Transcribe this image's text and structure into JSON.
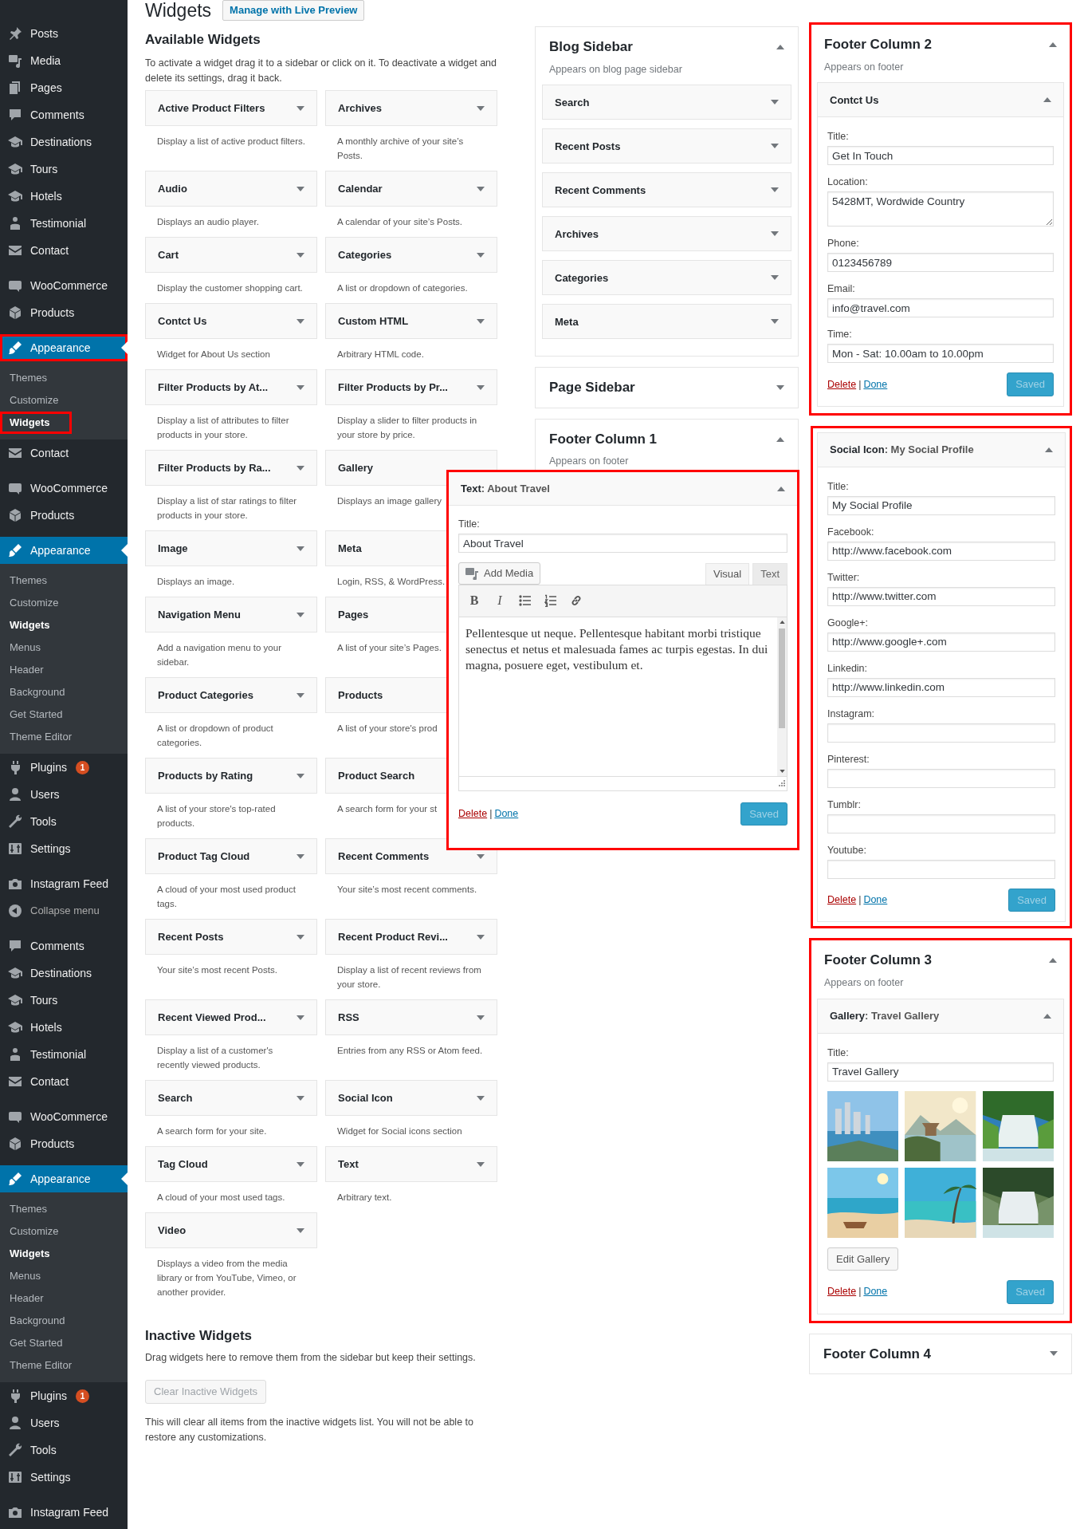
{
  "page": {
    "title": "Widgets",
    "live_preview": "Manage with Live Preview"
  },
  "admin_menu": [
    {
      "label": "Posts",
      "kind": "pin",
      "current": false,
      "highlighted": false
    },
    {
      "label": "Media",
      "kind": "media",
      "current": false,
      "highlighted": false
    },
    {
      "label": "Pages",
      "kind": "pages",
      "current": false,
      "highlighted": false
    },
    {
      "label": "Comments",
      "kind": "comment",
      "current": false,
      "highlighted": false
    },
    {
      "label": "Destinations",
      "kind": "cap",
      "current": false,
      "highlighted": false
    },
    {
      "label": "Tours",
      "kind": "cap",
      "current": false,
      "highlighted": false
    },
    {
      "label": "Hotels",
      "kind": "cap",
      "current": false,
      "highlighted": false
    },
    {
      "label": "Testimonial",
      "kind": "person",
      "current": false,
      "highlighted": false
    },
    {
      "label": "Contact",
      "kind": "mail",
      "current": false,
      "highlighted": false
    },
    {
      "label": "WooCommerce",
      "kind": "woo",
      "current": false,
      "highlighted": false
    },
    {
      "label": "Products",
      "kind": "cube",
      "current": false,
      "highlighted": false
    },
    {
      "label": "Appearance",
      "kind": "brush",
      "current": true,
      "highlighted": true,
      "submenu": [
        {
          "label": "Themes",
          "current": false,
          "highlighted": false
        },
        {
          "label": "Customize",
          "current": false,
          "highlighted": false
        },
        {
          "label": "Widgets",
          "current": true,
          "highlighted": true
        }
      ]
    },
    {
      "label": "Contact",
      "kind": "mail",
      "current": false,
      "highlighted": false
    },
    {
      "label": "WooCommerce",
      "kind": "woo",
      "current": false,
      "highlighted": false
    },
    {
      "label": "Products",
      "kind": "cube",
      "current": false,
      "highlighted": false
    },
    {
      "label": "Appearance",
      "kind": "brush",
      "current": true,
      "highlighted": false,
      "submenu": [
        {
          "label": "Themes",
          "current": false,
          "highlighted": false
        },
        {
          "label": "Customize",
          "current": false,
          "highlighted": false
        },
        {
          "label": "Widgets",
          "current": true,
          "highlighted": false
        },
        {
          "label": "Menus",
          "current": false,
          "highlighted": false
        },
        {
          "label": "Header",
          "current": false,
          "highlighted": false
        },
        {
          "label": "Background",
          "current": false,
          "highlighted": false
        },
        {
          "label": "Get Started",
          "current": false,
          "highlighted": false
        },
        {
          "label": "Theme Editor",
          "current": false,
          "highlighted": false
        }
      ]
    },
    {
      "label": "Plugins",
      "kind": "plug",
      "badge": "1",
      "current": false,
      "highlighted": false
    },
    {
      "label": "Users",
      "kind": "user",
      "current": false,
      "highlighted": false
    },
    {
      "label": "Tools",
      "kind": "wrench",
      "current": false,
      "highlighted": false
    },
    {
      "label": "Settings",
      "kind": "sliders",
      "current": false,
      "highlighted": false
    },
    {
      "label": "Instagram Feed",
      "kind": "camera",
      "current": false,
      "highlighted": false
    },
    {
      "label": "Collapse menu",
      "kind": "collapse",
      "current": false,
      "highlighted": false
    },
    {
      "label": "Comments",
      "kind": "comment",
      "current": false,
      "highlighted": false
    },
    {
      "label": "Destinations",
      "kind": "cap",
      "current": false,
      "highlighted": false
    },
    {
      "label": "Tours",
      "kind": "cap",
      "current": false,
      "highlighted": false
    },
    {
      "label": "Hotels",
      "kind": "cap",
      "current": false,
      "highlighted": false
    },
    {
      "label": "Testimonial",
      "kind": "person",
      "current": false,
      "highlighted": false
    },
    {
      "label": "Contact",
      "kind": "mail",
      "current": false,
      "highlighted": false
    },
    {
      "label": "WooCommerce",
      "kind": "woo",
      "current": false,
      "highlighted": false
    },
    {
      "label": "Products",
      "kind": "cube",
      "current": false,
      "highlighted": false
    },
    {
      "label": "Appearance",
      "kind": "brush",
      "current": true,
      "highlighted": false,
      "submenu": [
        {
          "label": "Themes",
          "current": false,
          "highlighted": false
        },
        {
          "label": "Customize",
          "current": false,
          "highlighted": false
        },
        {
          "label": "Widgets",
          "current": true,
          "highlighted": false
        },
        {
          "label": "Menus",
          "current": false,
          "highlighted": false
        },
        {
          "label": "Header",
          "current": false,
          "highlighted": false
        },
        {
          "label": "Background",
          "current": false,
          "highlighted": false
        },
        {
          "label": "Get Started",
          "current": false,
          "highlighted": false
        },
        {
          "label": "Theme Editor",
          "current": false,
          "highlighted": false
        }
      ]
    },
    {
      "label": "Plugins",
      "kind": "plug",
      "badge": "1",
      "current": false,
      "highlighted": false
    },
    {
      "label": "Users",
      "kind": "user",
      "current": false,
      "highlighted": false
    },
    {
      "label": "Tools",
      "kind": "wrench",
      "current": false,
      "highlighted": false
    },
    {
      "label": "Settings",
      "kind": "sliders",
      "current": false,
      "highlighted": false
    },
    {
      "label": "Instagram Feed",
      "kind": "camera",
      "current": false,
      "highlighted": false
    }
  ],
  "available": {
    "heading": "Available Widgets",
    "description": "To activate a widget drag it to a sidebar or click on it. To deactivate a widget and delete its settings, drag it back.",
    "widgets": [
      {
        "name": "Active Product Filters",
        "description": "Display a list of active product filters."
      },
      {
        "name": "Archives",
        "description": "A monthly archive of your site’s Posts."
      },
      {
        "name": "Audio",
        "description": "Displays an audio player."
      },
      {
        "name": "Calendar",
        "description": "A calendar of your site’s Posts."
      },
      {
        "name": "Cart",
        "description": "Display the customer shopping cart."
      },
      {
        "name": "Categories",
        "description": "A list or dropdown of categories."
      },
      {
        "name": "Contct Us",
        "description": "Widget for About Us section"
      },
      {
        "name": "Custom HTML",
        "description": "Arbitrary HTML code."
      },
      {
        "name": "Filter Products by At...",
        "description": "Display a list of attributes to filter products in your store."
      },
      {
        "name": "Filter Products by Pr...",
        "description": "Display a slider to filter products in your store by price."
      },
      {
        "name": "Filter Products by Ra...",
        "description": "Display a list of star ratings to filter products in your store."
      },
      {
        "name": "Gallery",
        "description": "Displays an image gallery"
      },
      {
        "name": "Image",
        "description": "Displays an image."
      },
      {
        "name": "Meta",
        "description": "Login, RSS, & WordPress."
      },
      {
        "name": "Navigation Menu",
        "description": "Add a navigation menu to your sidebar."
      },
      {
        "name": "Pages",
        "description": "A list of your site’s Pages."
      },
      {
        "name": "Product Categories",
        "description": "A list or dropdown of product categories."
      },
      {
        "name": "Products",
        "description": "A list of your store's prod"
      },
      {
        "name": "Products by Rating",
        "description": "A list of your store's top-rated products."
      },
      {
        "name": "Product Search",
        "description": "A search form for your st"
      },
      {
        "name": "Product Tag Cloud",
        "description": "A cloud of your most used product tags."
      },
      {
        "name": "Recent Comments",
        "description": "Your site’s most recent comments."
      },
      {
        "name": "Recent Posts",
        "description": "Your site’s most recent Posts."
      },
      {
        "name": "Recent Product Revi...",
        "description": "Display a list of recent reviews from your store."
      },
      {
        "name": "Recent Viewed Prod...",
        "description": "Display a list of a customer's recently viewed products."
      },
      {
        "name": "RSS",
        "description": "Entries from any RSS or Atom feed."
      },
      {
        "name": "Search",
        "description": "A search form for your site."
      },
      {
        "name": "Social Icon",
        "description": "Widget for Social icons section"
      },
      {
        "name": "Tag Cloud",
        "description": "A cloud of your most used tags."
      },
      {
        "name": "Text",
        "description": "Arbitrary text."
      },
      {
        "name": "Video",
        "description": "Displays a video from the media library or from YouTube, Vimeo, or another provider."
      }
    ]
  },
  "inactive": {
    "heading": "Inactive Widgets",
    "description": "Drag widgets here to remove them from the sidebar but keep their settings.",
    "clear_button": {
      "label": "Clear Inactive Widgets",
      "disabled": true
    },
    "note": "This will clear all items from the inactive widgets list. You will not be able to restore any customizations."
  },
  "sidebars": [
    {
      "title": "Blog Sidebar",
      "description": "Appears on blog page sidebar",
      "expanded": true,
      "highlighted": false,
      "widgets": [
        {
          "name": "Search",
          "expanded": false
        },
        {
          "name": "Recent Posts",
          "expanded": false
        },
        {
          "name": "Recent Comments",
          "expanded": false
        },
        {
          "name": "Archives",
          "expanded": false
        },
        {
          "name": "Categories",
          "expanded": false
        },
        {
          "name": "Meta",
          "expanded": false
        }
      ]
    },
    {
      "title": "Page Sidebar",
      "expanded": false,
      "highlighted": false
    },
    {
      "title": "Footer Column 1",
      "description": "Appears on footer",
      "expanded": true,
      "highlighted": false
    }
  ],
  "floating_widget": {
    "name": "Text",
    "in_title": ": About Travel",
    "expanded": true,
    "highlighted": true,
    "fields": [
      {
        "label": "Title:",
        "value": "About Travel",
        "kind": "text"
      }
    ],
    "add_media": "Add Media",
    "editor_tabs": [
      {
        "label": "Visual",
        "selected": true
      },
      {
        "label": "Text",
        "selected": false
      }
    ],
    "toolbar": [
      {
        "kind": "bold",
        "label": "B"
      },
      {
        "kind": "italic",
        "label": "I"
      },
      {
        "kind": "bullet-list"
      },
      {
        "kind": "numbered-list"
      },
      {
        "kind": "link"
      }
    ],
    "content": "Pellentesque ut neque. Pellentesque habitant morbi tristique senectus et netus et malesuada fames ac turpis egestas. In dui magna, posuere eget, vestibulum et.",
    "delete": "Delete",
    "separator": "|",
    "done": "Done",
    "save": {
      "label": "Saved",
      "disabled": true
    }
  },
  "right_column": [
    {
      "kind": "panel",
      "title": "Footer Column 2",
      "description": "Appears on footer",
      "expanded": true,
      "highlighted": true,
      "widgets": [
        {
          "name": "Contct Us",
          "expanded": true,
          "fields": [
            {
              "label": "Title:",
              "value": "Get In Touch",
              "kind": "text"
            },
            {
              "label": "Location:",
              "value": "5428MT, Wordwide Country",
              "kind": "textarea"
            },
            {
              "label": "Phone:",
              "value": "0123456789",
              "kind": "text"
            },
            {
              "label": "Email:",
              "value": "info@travel.com",
              "kind": "text"
            },
            {
              "label": "Time:",
              "value": "Mon - Sat: 10.00am to 10.00pm",
              "kind": "text"
            }
          ],
          "delete": "Delete",
          "separator": "|",
          "done": "Done",
          "save": {
            "label": "Saved",
            "disabled": true
          }
        }
      ]
    },
    {
      "kind": "widget",
      "highlighted": true,
      "widget": {
        "name": "Social Icon",
        "in_title": ": My Social Profile",
        "expanded": true,
        "fields": [
          {
            "label": "Title:",
            "value": "My Social Profile",
            "kind": "text"
          },
          {
            "label": "Facebook:",
            "value": "http://www.facebook.com",
            "kind": "text"
          },
          {
            "label": "Twitter:",
            "value": "http://www.twitter.com",
            "kind": "text"
          },
          {
            "label": "Google+:",
            "value": "http://www.google+.com",
            "kind": "text"
          },
          {
            "label": "Linkedin:",
            "value": "http://www.linkedin.com",
            "kind": "text"
          },
          {
            "label": "Instagram:",
            "kind": "text"
          },
          {
            "label": "Pinterest:",
            "kind": "text"
          },
          {
            "label": "Tumblr:",
            "kind": "text"
          },
          {
            "label": "Youtube:",
            "kind": "text"
          }
        ],
        "delete": "Delete",
        "separator": "|",
        "done": "Done",
        "save": {
          "label": "Saved",
          "disabled": true
        }
      }
    },
    {
      "kind": "panel",
      "title": "Footer Column 3",
      "description": "Appears on footer",
      "expanded": true,
      "highlighted": true,
      "widgets": [
        {
          "name": "Gallery",
          "in_title": ": Travel Gallery",
          "expanded": true,
          "fields": [
            {
              "label": "Title:",
              "value": "Travel Gallery",
              "kind": "text"
            }
          ],
          "gallery": [
            {
              "kind": "picture"
            },
            {
              "kind": "picture"
            },
            {
              "kind": "picture"
            },
            {
              "kind": "picture"
            },
            {
              "kind": "picture"
            },
            {
              "kind": "picture"
            }
          ],
          "edit_button": "Edit Gallery",
          "delete": "Delete",
          "separator": "|",
          "done": "Done",
          "save": {
            "label": "Saved",
            "disabled": true
          }
        }
      ]
    },
    {
      "kind": "panel",
      "title": "Footer Column 4",
      "expanded": false,
      "highlighted": false
    }
  ]
}
